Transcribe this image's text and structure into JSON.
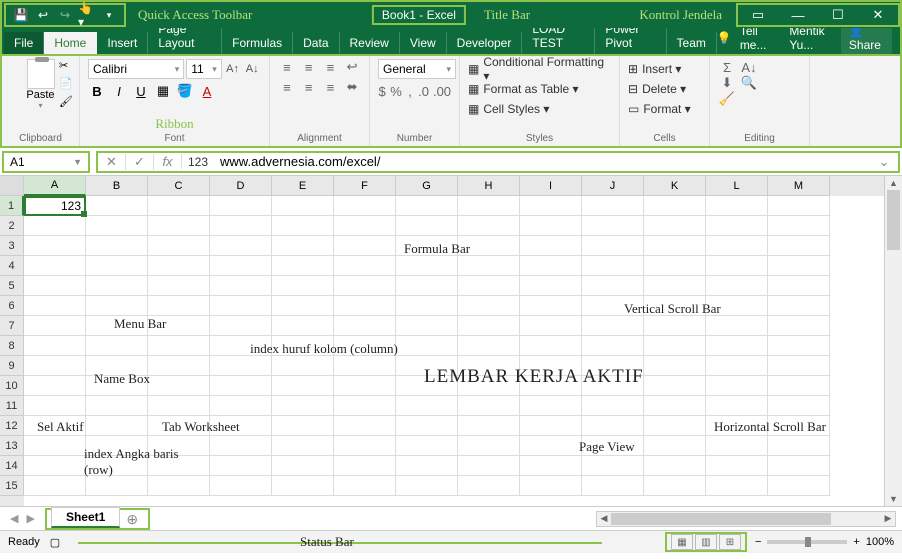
{
  "qat_label": "Quick Access Toolbar",
  "title_book": "Book1 - Excel",
  "title_bar_label": "Title Bar",
  "kontrol_label": "Kontrol Jendela",
  "tabs": [
    "File",
    "Home",
    "Insert",
    "Page Layout",
    "Formulas",
    "Data",
    "Review",
    "View",
    "Developer",
    "LOAD TEST",
    "Power Pivot",
    "Team"
  ],
  "tell_me": "Tell me...",
  "user": "Mentik Yu...",
  "share": "Share",
  "ribbon_label": "Ribbon",
  "groups": {
    "clipboard": "Clipboard",
    "font": "Font",
    "alignment": "Alignment",
    "number": "Number",
    "styles": "Styles",
    "cells": "Cells",
    "editing": "Editing"
  },
  "paste": "Paste",
  "font_name": "Calibri",
  "font_size": "11",
  "number_format": "General",
  "styles_items": [
    "Conditional Formatting ▾",
    "Format as Table ▾",
    "Cell Styles ▾"
  ],
  "cells_items": [
    "Insert ▾",
    "Delete ▾",
    "Format ▾"
  ],
  "name_box": "A1",
  "formula_prefix": "123",
  "formula_value": "www.advernesia.com/excel/",
  "columns": [
    "A",
    "B",
    "C",
    "D",
    "E",
    "F",
    "G",
    "H",
    "I",
    "J",
    "K",
    "L",
    "M"
  ],
  "rows": [
    "1",
    "2",
    "3",
    "4",
    "5",
    "6",
    "7",
    "8",
    "9",
    "10",
    "11",
    "12",
    "13",
    "14",
    "15"
  ],
  "active_cell_value": "123",
  "annotations": {
    "menu_bar": "Menu Bar",
    "name_box": "Name Box",
    "formula_bar": "Formula Bar",
    "index_kolom": "index huruf kolom (column)",
    "sel_aktif": "Sel Aktif",
    "index_baris": "index Angka baris (row)",
    "tab_worksheet": "Tab Worksheet",
    "lembar": "LEMBAR KERJA AKTIF",
    "vscroll": "Vertical Scroll Bar",
    "hscroll": "Horizontal Scroll Bar",
    "page_view": "Page View",
    "status_bar": "Status Bar"
  },
  "sheet_tab": "Sheet1",
  "status_ready": "Ready",
  "zoom_pct": "100%"
}
